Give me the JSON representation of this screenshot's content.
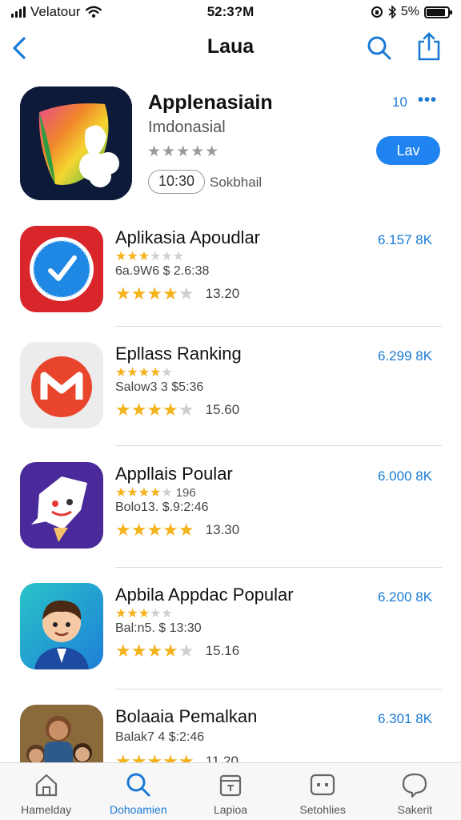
{
  "status_bar": {
    "carrier": "Velatour",
    "time": "52:3?M",
    "battery_text": "5%",
    "battery_level": 0.9
  },
  "nav": {
    "title": "Laua",
    "back_icon": "chevron-left-icon",
    "search_icon": "search-icon",
    "share_icon": "share-icon"
  },
  "featured": {
    "name": "Applenasiain",
    "subtitle": "Imdonasial",
    "stars": "★★★★★",
    "time_badge": "10:30",
    "meta": "Sokbhail",
    "count": "10",
    "more": "•••",
    "get_label": "Lav"
  },
  "apps": [
    {
      "name": "Aplikasia Apoudlar",
      "stars_small_on": "★★★",
      "stars_small_off": "★★★",
      "stars_small_extra": "",
      "meta": "6a.9W6 $ 2.6:38",
      "stars_big_on": "★★★★",
      "stars_big_off": "★",
      "score": "13.20",
      "price": "6.157 8K"
    },
    {
      "name": "Epllass Ranking",
      "stars_small_on": "★★★★",
      "stars_small_off": "★",
      "stars_small_extra": "",
      "meta": "Salow3 3 $5:36",
      "stars_big_on": "★★★★",
      "stars_big_off": "★",
      "score": "15.60",
      "price": "6.299 8K"
    },
    {
      "name": "Appllais Poular",
      "stars_small_on": "★★★★",
      "stars_small_off": "★",
      "stars_small_extra": "196",
      "meta": "Bolo13. $.9:2:46",
      "stars_big_on": "★★★★★",
      "stars_big_off": "",
      "score": "13.30",
      "price": "6.000 8K"
    },
    {
      "name": "Apbila Appdac Popular",
      "stars_small_on": "★★★",
      "stars_small_off": "★★",
      "stars_small_extra": "",
      "meta": "Bal:n5. $ 13:30",
      "stars_big_on": "★★★★",
      "stars_big_off": "★",
      "score": "15.16",
      "price": "6.200 8K"
    },
    {
      "name": "Bolaaia Pemalkan",
      "stars_small_on": "",
      "stars_small_off": "",
      "stars_small_extra": "",
      "meta": "Balak7 4 $:2:46",
      "stars_big_on": "★★★★★",
      "stars_big_off": "",
      "score": "11.20",
      "price": "6.301 8K"
    }
  ],
  "tabs": [
    {
      "label": "Hamelday",
      "icon": "home-icon",
      "active": false
    },
    {
      "label": "Dohoamien",
      "icon": "search-icon",
      "active": true
    },
    {
      "label": "Lapioa",
      "icon": "archive-icon",
      "active": false
    },
    {
      "label": "Setohlies",
      "icon": "games-icon",
      "active": false
    },
    {
      "label": "Sakerit",
      "icon": "chat-bubble-icon",
      "active": false
    }
  ],
  "colors": {
    "accent": "#1f83f0",
    "star": "#f4b21b",
    "link": "#1a7ad6"
  }
}
